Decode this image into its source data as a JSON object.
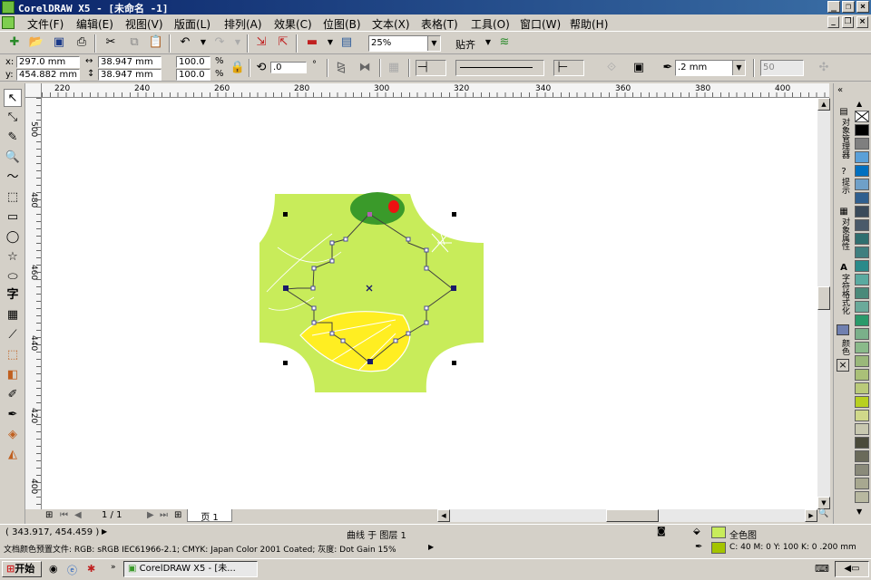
{
  "title": "CorelDRAW X5 - [未命名 -1]",
  "menu": [
    "文件(F)",
    "编辑(E)",
    "视图(V)",
    "版面(L)",
    "排列(A)",
    "效果(C)",
    "位图(B)",
    "文本(X)",
    "表格(T)",
    "工具(O)",
    "窗口(W)",
    "帮助(H)"
  ],
  "toolbar": {
    "zoom": "25%",
    "snap": "贴齐"
  },
  "props": {
    "x": "297.0 mm",
    "y": "454.882 mm",
    "w": "38.947 mm",
    "h": "38.947 mm",
    "sx": "100.0",
    "sy": "100.0",
    "pct": "%",
    "angle": ".0",
    "deg": "°",
    "outline": ".2 mm",
    "smooth": "50"
  },
  "ruler_h": [
    "220",
    "240",
    "260",
    "280",
    "300",
    "320",
    "340",
    "360",
    "380",
    "400"
  ],
  "ruler_v": [
    "500",
    "480",
    "460",
    "440",
    "420",
    "400"
  ],
  "page": {
    "count": "1 / 1",
    "tab": "页 1"
  },
  "docker_tabs": [
    "对象管理器",
    "提示",
    "对象属性",
    "字符格式化",
    "颜色"
  ],
  "palette": [
    "#ffffff",
    "#000000",
    "#7f7f7f",
    "#5aa0d8",
    "#0070c0",
    "#6fa0c8",
    "#2f5f8f",
    "#3a4a5a",
    "#4a5a6a",
    "#2f6f6f",
    "#3f7f7f",
    "#2a8a8a",
    "#5aaaa0",
    "#4a8a7a",
    "#6aaa9a",
    "#2a9a6a",
    "#7ab08a",
    "#8aba8a",
    "#9ab87a",
    "#aac078",
    "#baca7a",
    "#b8d020",
    "#d0d88a",
    "#c8c8b0",
    "#4a4a3a",
    "#6a6a5a",
    "#8a8a7a",
    "#a8a890",
    "#b8b8a0"
  ],
  "status": {
    "coords": "( 343.917, 454.459 )",
    "object": "曲线 于 图层 1",
    "fill_label": "全色图",
    "profile": "文档颜色预置文件: RGB: sRGB IEC61966-2.1; CMYK: Japan Color 2001 Coated; 灰度: Dot Gain 15%",
    "outline_info": "C: 40 M: 0 Y: 100 K: 0  .200 mm"
  },
  "taskbar": {
    "start": "开始",
    "task": "CorelDRAW X5 - [未..."
  },
  "colors": {
    "shape_fill": "#c8ec5a",
    "outline_swatch": "#a4c400",
    "green": "#3a9a2a",
    "lemon": "#ffee22"
  }
}
